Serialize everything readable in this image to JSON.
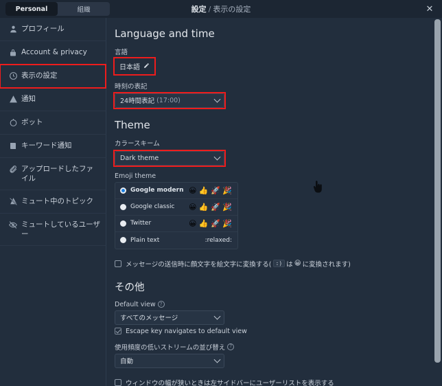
{
  "header": {
    "title_main": "設定",
    "separator": "/",
    "title_sub": "表示の設定",
    "close_label": "✕",
    "close_icon": "close-icon"
  },
  "tabs": [
    {
      "label": "Personal",
      "active": true
    },
    {
      "label": "組織",
      "active": false
    }
  ],
  "sidebar": {
    "items": [
      {
        "label": "プロフィール",
        "icon": "user-icon",
        "highlighted": false
      },
      {
        "label": "Account & privacy",
        "icon": "lock-icon",
        "highlighted": false
      },
      {
        "label": "表示の設定",
        "icon": "clock-icon",
        "highlighted": true
      },
      {
        "label": "通知",
        "icon": "bell-icon",
        "highlighted": false
      },
      {
        "label": "ボット",
        "icon": "bot-icon",
        "highlighted": false
      },
      {
        "label": "キーワード通知",
        "icon": "book-icon",
        "highlighted": false
      },
      {
        "label": "アップロードしたファイル",
        "icon": "paperclip-icon",
        "highlighted": false
      },
      {
        "label": "ミュート中のトピック",
        "icon": "mute-bell-icon",
        "highlighted": false
      },
      {
        "label": "ミュートしているユーザー",
        "icon": "eye-off-icon",
        "highlighted": false
      }
    ]
  },
  "main": {
    "language_section": {
      "title": "Language and time",
      "language_label": "言語",
      "language_value": "日本語",
      "edit_icon": "pencil-icon",
      "time_label": "時刻の表記",
      "time_value": "24時間表記",
      "time_value_suffix": "(17:00)"
    },
    "theme_section": {
      "title": "Theme",
      "colorscheme_label": "カラースキーム",
      "colorscheme_value": "Dark theme",
      "emoji_label": "Emoji theme",
      "emoji_options": [
        {
          "name": "Google modern",
          "selected": true,
          "glyphs": "😀 👍 🚀 🎉"
        },
        {
          "name": "Google classic",
          "selected": false,
          "glyphs": "😀 👍 🚀 🎉"
        },
        {
          "name": "Twitter",
          "selected": false,
          "glyphs": "😀 👍 🚀 🎉"
        },
        {
          "name": "Plain text",
          "selected": false,
          "glyphs": ":relaxed:"
        }
      ],
      "emoticon_checkbox": {
        "checked": false,
        "text_before": "メッセージの送信時に顔文字を絵文字に変換する(",
        "code": ":)",
        "text_middle": "は",
        "emoji": "😀",
        "text_after": "に変換されます)"
      }
    },
    "other_section": {
      "title": "その他",
      "default_view_label": "Default view",
      "default_view_help": "?",
      "default_view_value": "すべてのメッセージ",
      "escape_checkbox": {
        "checked": true,
        "label": "Escape key navigates to default view"
      },
      "sort_label": "使用頻度の低いストリームの並び替え",
      "sort_help": "?",
      "sort_value": "自動",
      "userlist_checkbox": {
        "checked": false,
        "label": "ウィンドウの幅が狭いときは左サイドバーにユーザーリストを表示する"
      }
    }
  },
  "colors": {
    "background": "#222e3d",
    "topbar": "#1c2633",
    "highlight_red": "#ef1c1c",
    "accent_blue": "#1a7fe0",
    "scrollbar": "#9aa4ae"
  }
}
